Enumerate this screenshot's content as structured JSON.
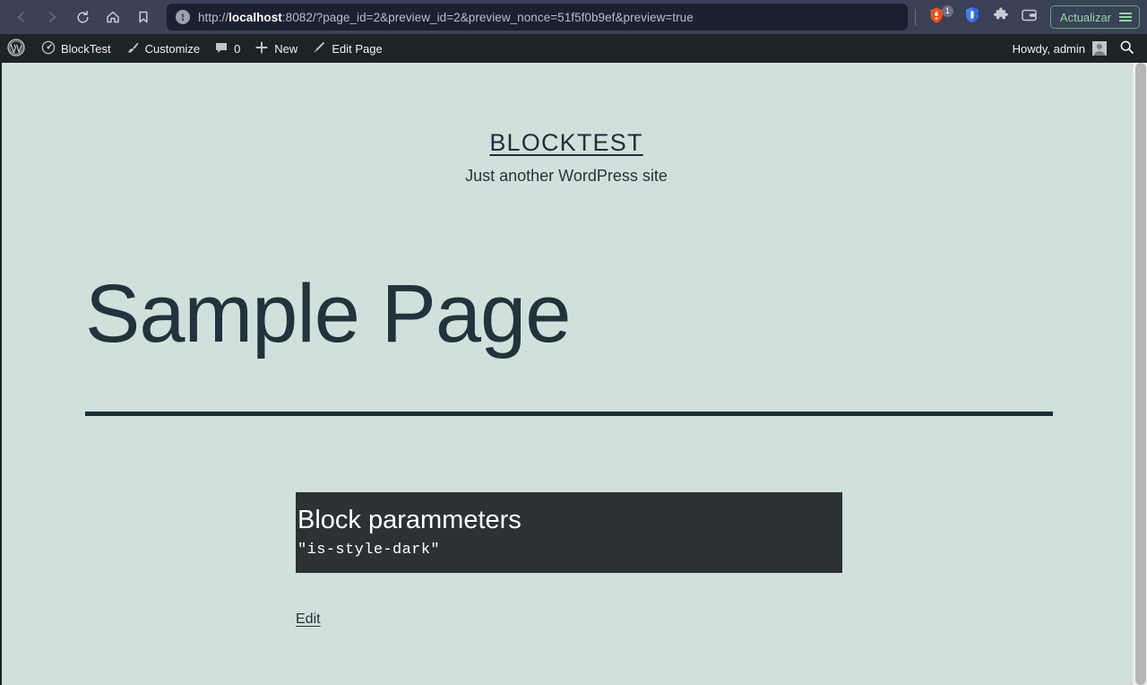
{
  "browser": {
    "nav": {
      "back": "back-arrow",
      "forward": "forward-arrow",
      "reload": "reload",
      "home": "home",
      "bookmark": "bookmark"
    },
    "url": {
      "scheme_prefix": "http://",
      "host": "localhost",
      "rest": ":8082/?page_id=2&preview_id=2&preview_nonce=51f5f0b9ef&preview=true",
      "full": "http://localhost:8082/?page_id=2&preview_id=2&preview_nonce=51f5f0b9ef&preview=true",
      "security_icon": "info-circle-icon"
    },
    "extensions": {
      "brave_badge_count": "1",
      "brave_icon": "brave-lion-icon",
      "shield_icon": "brave-shield-icon",
      "puzzle_icon": "extensions-puzzle-icon",
      "wallet_icon": "brave-wallet-icon"
    },
    "update_button_label": "Actualizar",
    "menu_icon": "hamburger-menu-icon",
    "chrome_color": "#3b4156",
    "urlbar_color": "#1c2030",
    "update_accent": "#8fd6a6"
  },
  "adminbar": {
    "background": "#1d2327",
    "wp_logo": "wordpress-logo-icon",
    "items": [
      {
        "label": "BlockTest",
        "icon": "dashboard-speedometer-icon"
      },
      {
        "label": "Customize",
        "icon": "paintbrush-icon"
      },
      {
        "label": "0",
        "icon": "comment-bubble-icon"
      },
      {
        "label": "New",
        "icon": "plus-icon"
      },
      {
        "label": "Edit Page",
        "icon": "pencil-icon"
      }
    ],
    "howdy": "Howdy, admin",
    "avatar": "user-avatar",
    "search_icon": "search-magnifier-icon"
  },
  "site": {
    "title": "BLOCKTEST",
    "tagline": "Just another WordPress site",
    "background": "#d1e0da",
    "text_color": "#22333d"
  },
  "main": {
    "page_title": "Sample Page",
    "separator": "horizontal-rule",
    "block": {
      "heading": "Block parammeters",
      "code": "\"is-style-dark\"",
      "background": "#2c3134",
      "text_color": "#ffffff"
    },
    "edit_link": "Edit"
  },
  "scrollbar": {
    "thumb_color": "#b6b6b6",
    "track_color": "#f0f0f0"
  }
}
